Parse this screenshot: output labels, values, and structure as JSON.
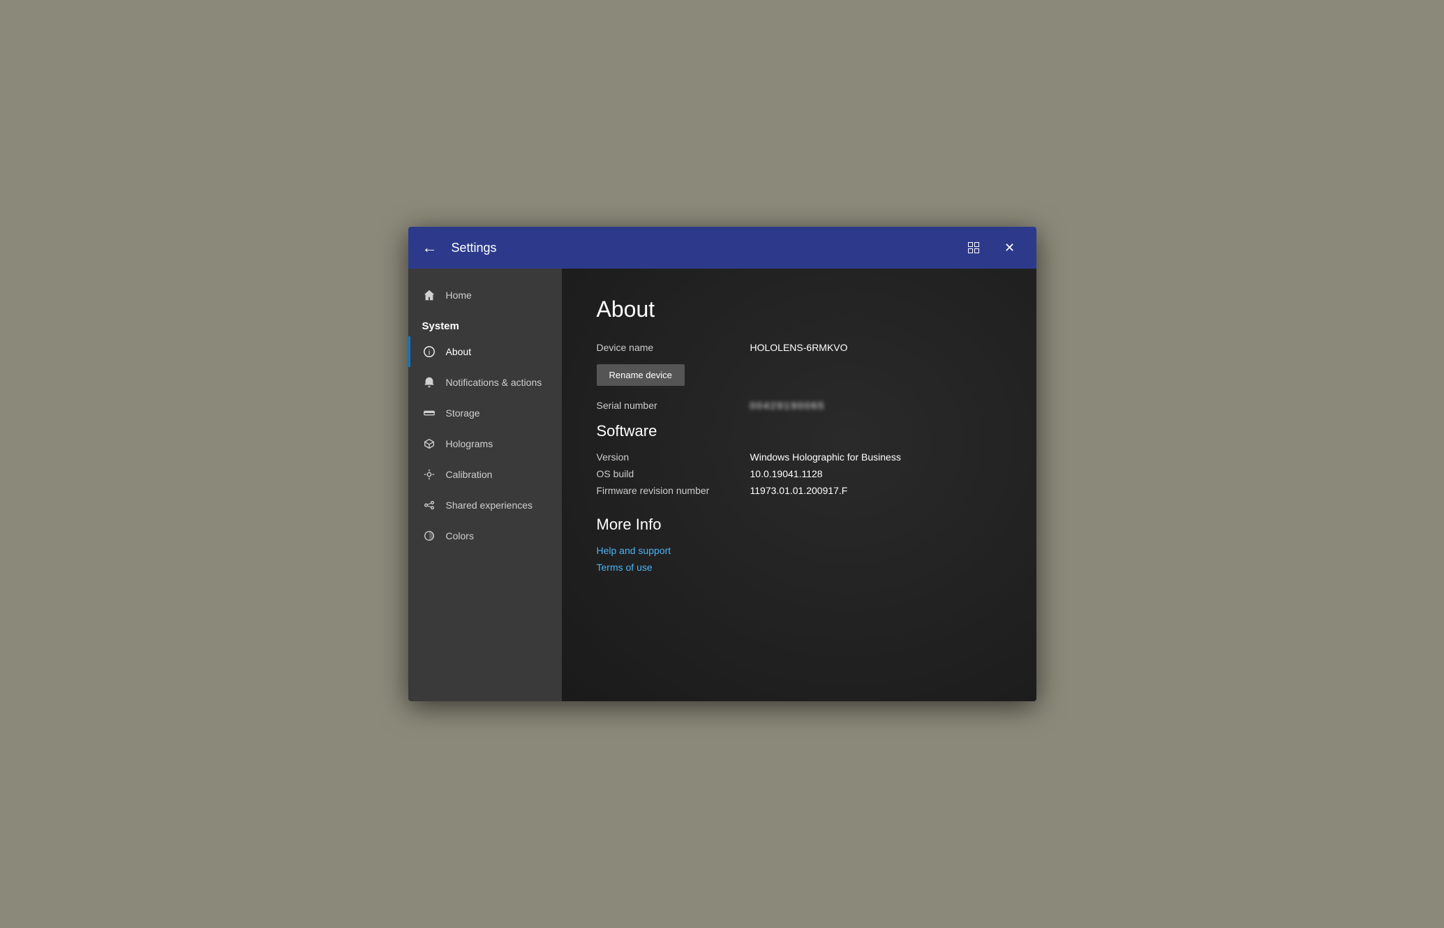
{
  "titlebar": {
    "title": "Settings",
    "back_label": "←",
    "close_label": "✕"
  },
  "sidebar": {
    "home_label": "Home",
    "section_label": "System",
    "items": [
      {
        "id": "about",
        "label": "About",
        "active": true,
        "icon": "info-icon"
      },
      {
        "id": "notifications",
        "label": "Notifications & actions",
        "active": false,
        "icon": "bell-icon"
      },
      {
        "id": "storage",
        "label": "Storage",
        "active": false,
        "icon": "storage-icon"
      },
      {
        "id": "holograms",
        "label": "Holograms",
        "active": false,
        "icon": "holograms-icon"
      },
      {
        "id": "calibration",
        "label": "Calibration",
        "active": false,
        "icon": "calibration-icon"
      },
      {
        "id": "shared",
        "label": "Shared experiences",
        "active": false,
        "icon": "shared-icon"
      },
      {
        "id": "colors",
        "label": "Colors",
        "active": false,
        "icon": "colors-icon"
      }
    ]
  },
  "main": {
    "page_title": "About",
    "device_name_label": "Device name",
    "device_name_value": "HOLOLENS-6RMKVO",
    "rename_button": "Rename device",
    "serial_label": "Serial number",
    "serial_value": "00429190065",
    "software_heading": "Software",
    "version_label": "Version",
    "version_value": "Windows Holographic for Business",
    "os_build_label": "OS build",
    "os_build_value": "10.0.19041.1128",
    "firmware_label": "Firmware revision number",
    "firmware_value": "11973.01.01.200917.F",
    "more_info_heading": "More Info",
    "help_link": "Help and support",
    "terms_link": "Terms of use"
  }
}
